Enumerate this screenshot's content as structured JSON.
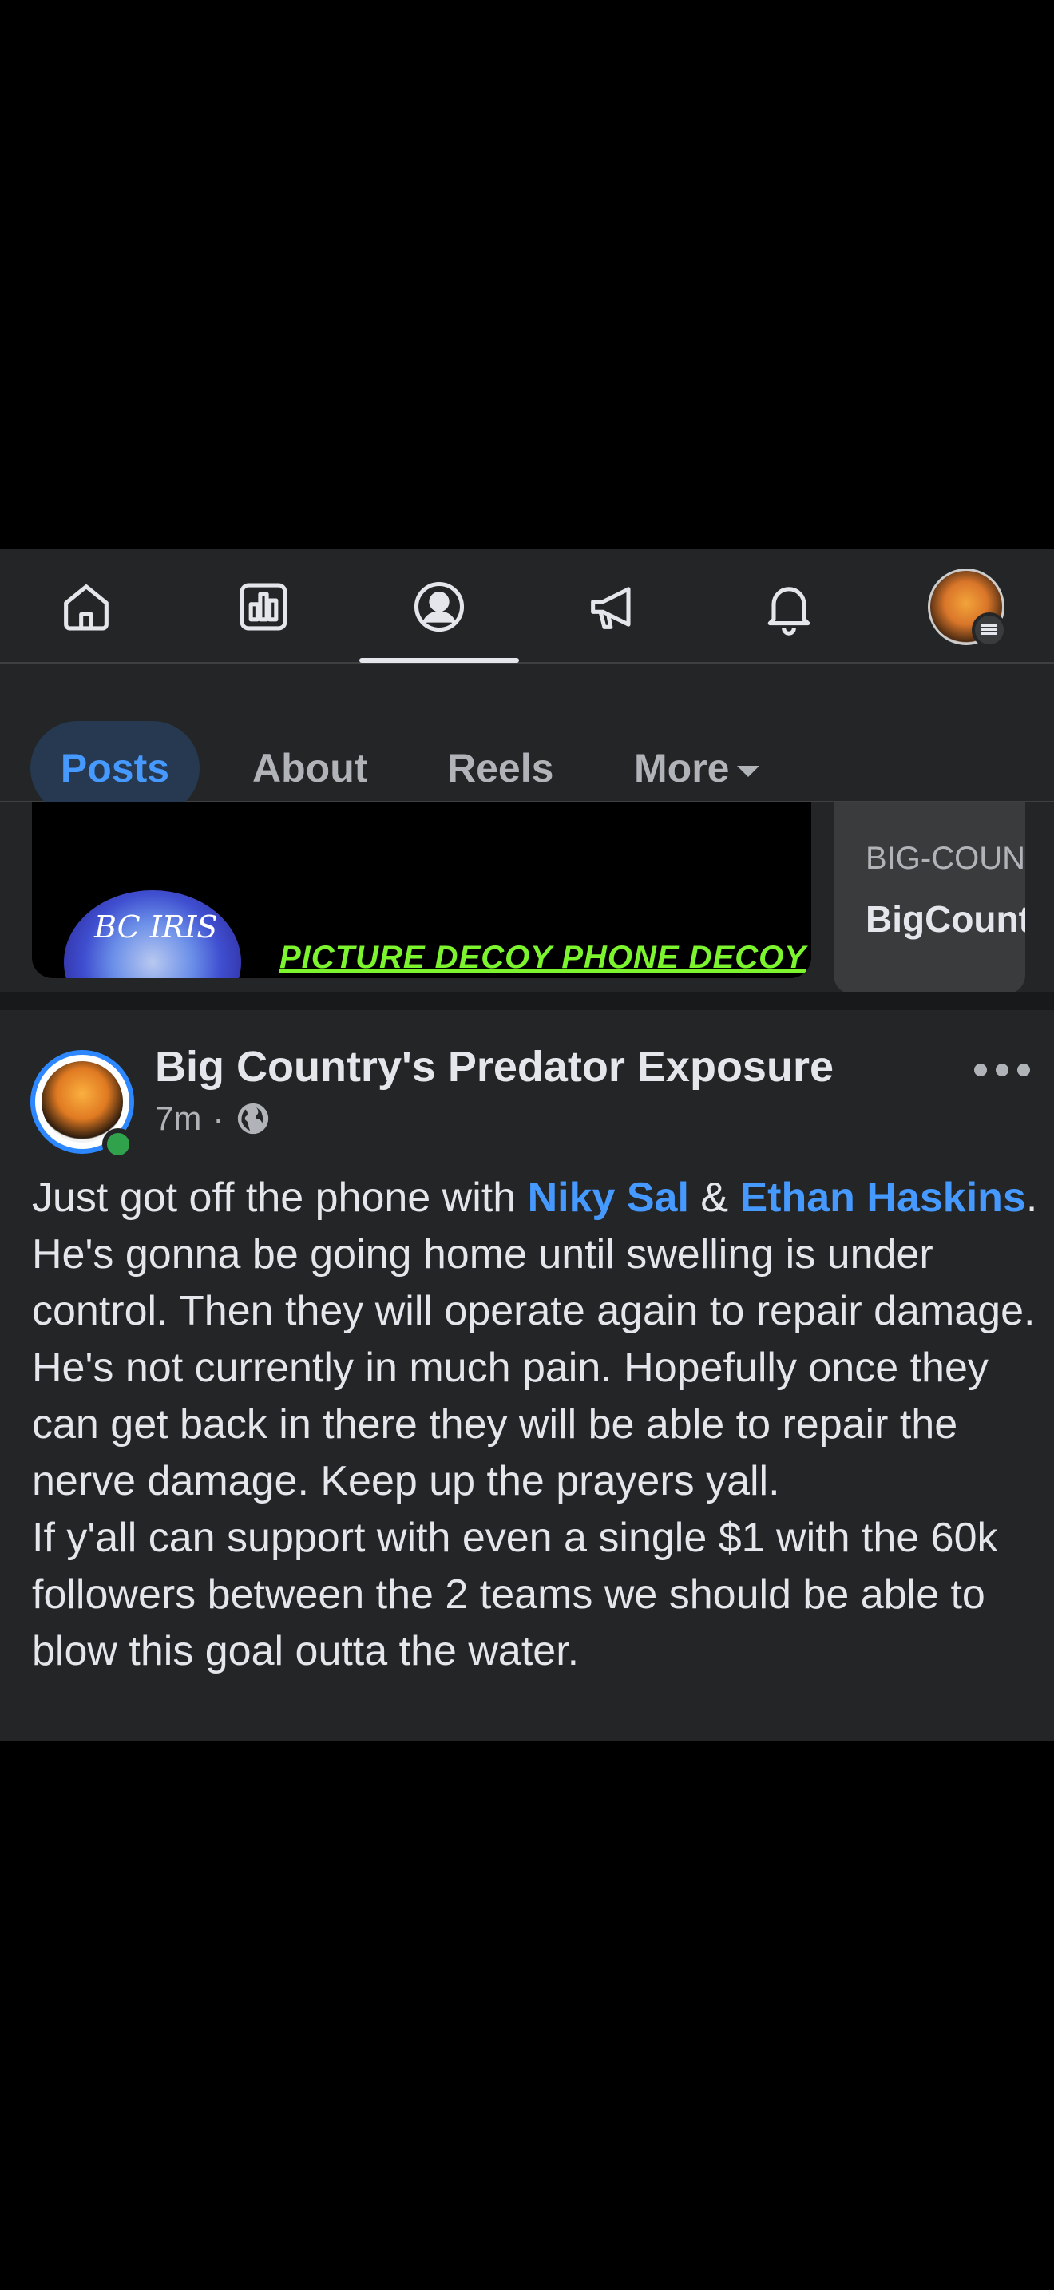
{
  "nav": {
    "icons": [
      "home-icon",
      "dashboard-icon",
      "profile-icon",
      "megaphone-icon",
      "bell-icon",
      "avatar-menu"
    ]
  },
  "tabs": {
    "posts": "Posts",
    "about": "About",
    "reels": "Reels",
    "more": "More"
  },
  "featured": {
    "logo_text": "BC IRIS",
    "caption": "PICTURE DECOY PHONE DECOY",
    "card2_kicker": "BIG-COUN",
    "card2_title": "BigCount"
  },
  "post": {
    "author": "Big Country's Predator Exposure",
    "time": "7m",
    "separator": "·",
    "body_1": "Just got off the phone with ",
    "mention_1": "Niky Sal",
    "body_2": " & ",
    "mention_2": "Ethan Haskins",
    "body_3": ". He's gonna be going home until swelling is under control. Then they will operate again to repair damage. He's not currently in much pain. Hopefully once they can get back in there they will be able to repair the nerve damage. Keep up the prayers yall.",
    "body_4": "If y'all can support with even a single $1 with the 60k followers between the 2 teams we should be able to blow this goal outta the water."
  },
  "colors": {
    "background": "#242526",
    "accent": "#4599ff",
    "online": "#31a24c",
    "caption_green": "#7df52e"
  }
}
